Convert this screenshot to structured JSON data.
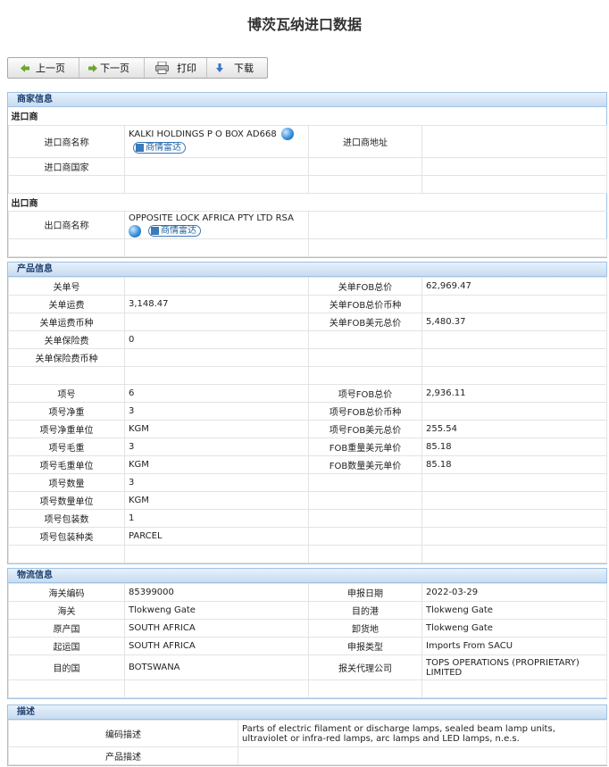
{
  "title": "博茨瓦纳进口数据",
  "toolbar": {
    "prev": "上一页",
    "next": "下一页",
    "print": "打印",
    "download": "下载"
  },
  "merchant": {
    "header": "商家信息",
    "importer_title": "进口商",
    "importer_name_label": "进口商名称",
    "importer_name": "KALKI HOLDINGS P O BOX AD668",
    "importer_address_label": "进口商地址",
    "importer_address": "",
    "importer_country_label": "进口商国家",
    "importer_country": "",
    "exporter_title": "出口商",
    "exporter_name_label": "出口商名称",
    "exporter_name": "OPPOSITE LOCK AFRICA PTY LTD RSA",
    "radar_label": "商情雷达"
  },
  "product": {
    "header": "产品信息",
    "rows": [
      {
        "l1": "关单号",
        "v1": "",
        "l2": "关单FOB总价",
        "v2": "62,969.47"
      },
      {
        "l1": "关单运费",
        "v1": "3,148.47",
        "l2": "关单FOB总价币种",
        "v2": ""
      },
      {
        "l1": "关单运费币种",
        "v1": "",
        "l2": "关单FOB美元总价",
        "v2": "5,480.37"
      },
      {
        "l1": "关单保险费",
        "v1": "0",
        "l2": "",
        "v2": ""
      },
      {
        "l1": "关单保险费币种",
        "v1": "",
        "l2": "",
        "v2": ""
      },
      {
        "l1": "",
        "v1": "",
        "l2": "",
        "v2": ""
      },
      {
        "l1": "项号",
        "v1": "6",
        "l2": "项号FOB总价",
        "v2": "2,936.11"
      },
      {
        "l1": "项号净重",
        "v1": "3",
        "l2": "项号FOB总价币种",
        "v2": ""
      },
      {
        "l1": "项号净重单位",
        "v1": "KGM",
        "l2": "项号FOB美元总价",
        "v2": "255.54"
      },
      {
        "l1": "项号毛重",
        "v1": "3",
        "l2": "FOB重量美元单价",
        "v2": "85.18"
      },
      {
        "l1": "项号毛重单位",
        "v1": "KGM",
        "l2": "FOB数量美元单价",
        "v2": "85.18"
      },
      {
        "l1": "项号数量",
        "v1": "3",
        "l2": "",
        "v2": ""
      },
      {
        "l1": "项号数量单位",
        "v1": "KGM",
        "l2": "",
        "v2": ""
      },
      {
        "l1": "项号包装数",
        "v1": "1",
        "l2": "",
        "v2": ""
      },
      {
        "l1": "项号包装种类",
        "v1": "PARCEL",
        "l2": "",
        "v2": ""
      },
      {
        "l1": "",
        "v1": "",
        "l2": "",
        "v2": ""
      }
    ]
  },
  "logistics": {
    "header": "物流信息",
    "rows": [
      {
        "l1": "海关编码",
        "v1": "85399000",
        "l2": "申报日期",
        "v2": "2022-03-29"
      },
      {
        "l1": "海关",
        "v1": "Tlokweng Gate",
        "l2": "目的港",
        "v2": "Tlokweng Gate"
      },
      {
        "l1": "原产国",
        "v1": "SOUTH AFRICA",
        "l2": "卸货地",
        "v2": "Tlokweng Gate"
      },
      {
        "l1": "起运国",
        "v1": "SOUTH AFRICA",
        "l2": "申报类型",
        "v2": "Imports From SACU"
      },
      {
        "l1": "目的国",
        "v1": "BOTSWANA",
        "l2": "报关代理公司",
        "v2": "TOPS OPERATIONS (PROPRIETARY) LIMITED"
      },
      {
        "l1": "",
        "v1": "",
        "l2": "",
        "v2": ""
      }
    ]
  },
  "description": {
    "header": "描述",
    "code_desc_label": "编码描述",
    "code_desc": "Parts of electric filament or discharge lamps, sealed beam lamp units, ultraviolet or infra-red lamps, arc lamps and LED lamps, n.e.s.",
    "product_desc_label": "产品描述",
    "product_desc": ""
  }
}
